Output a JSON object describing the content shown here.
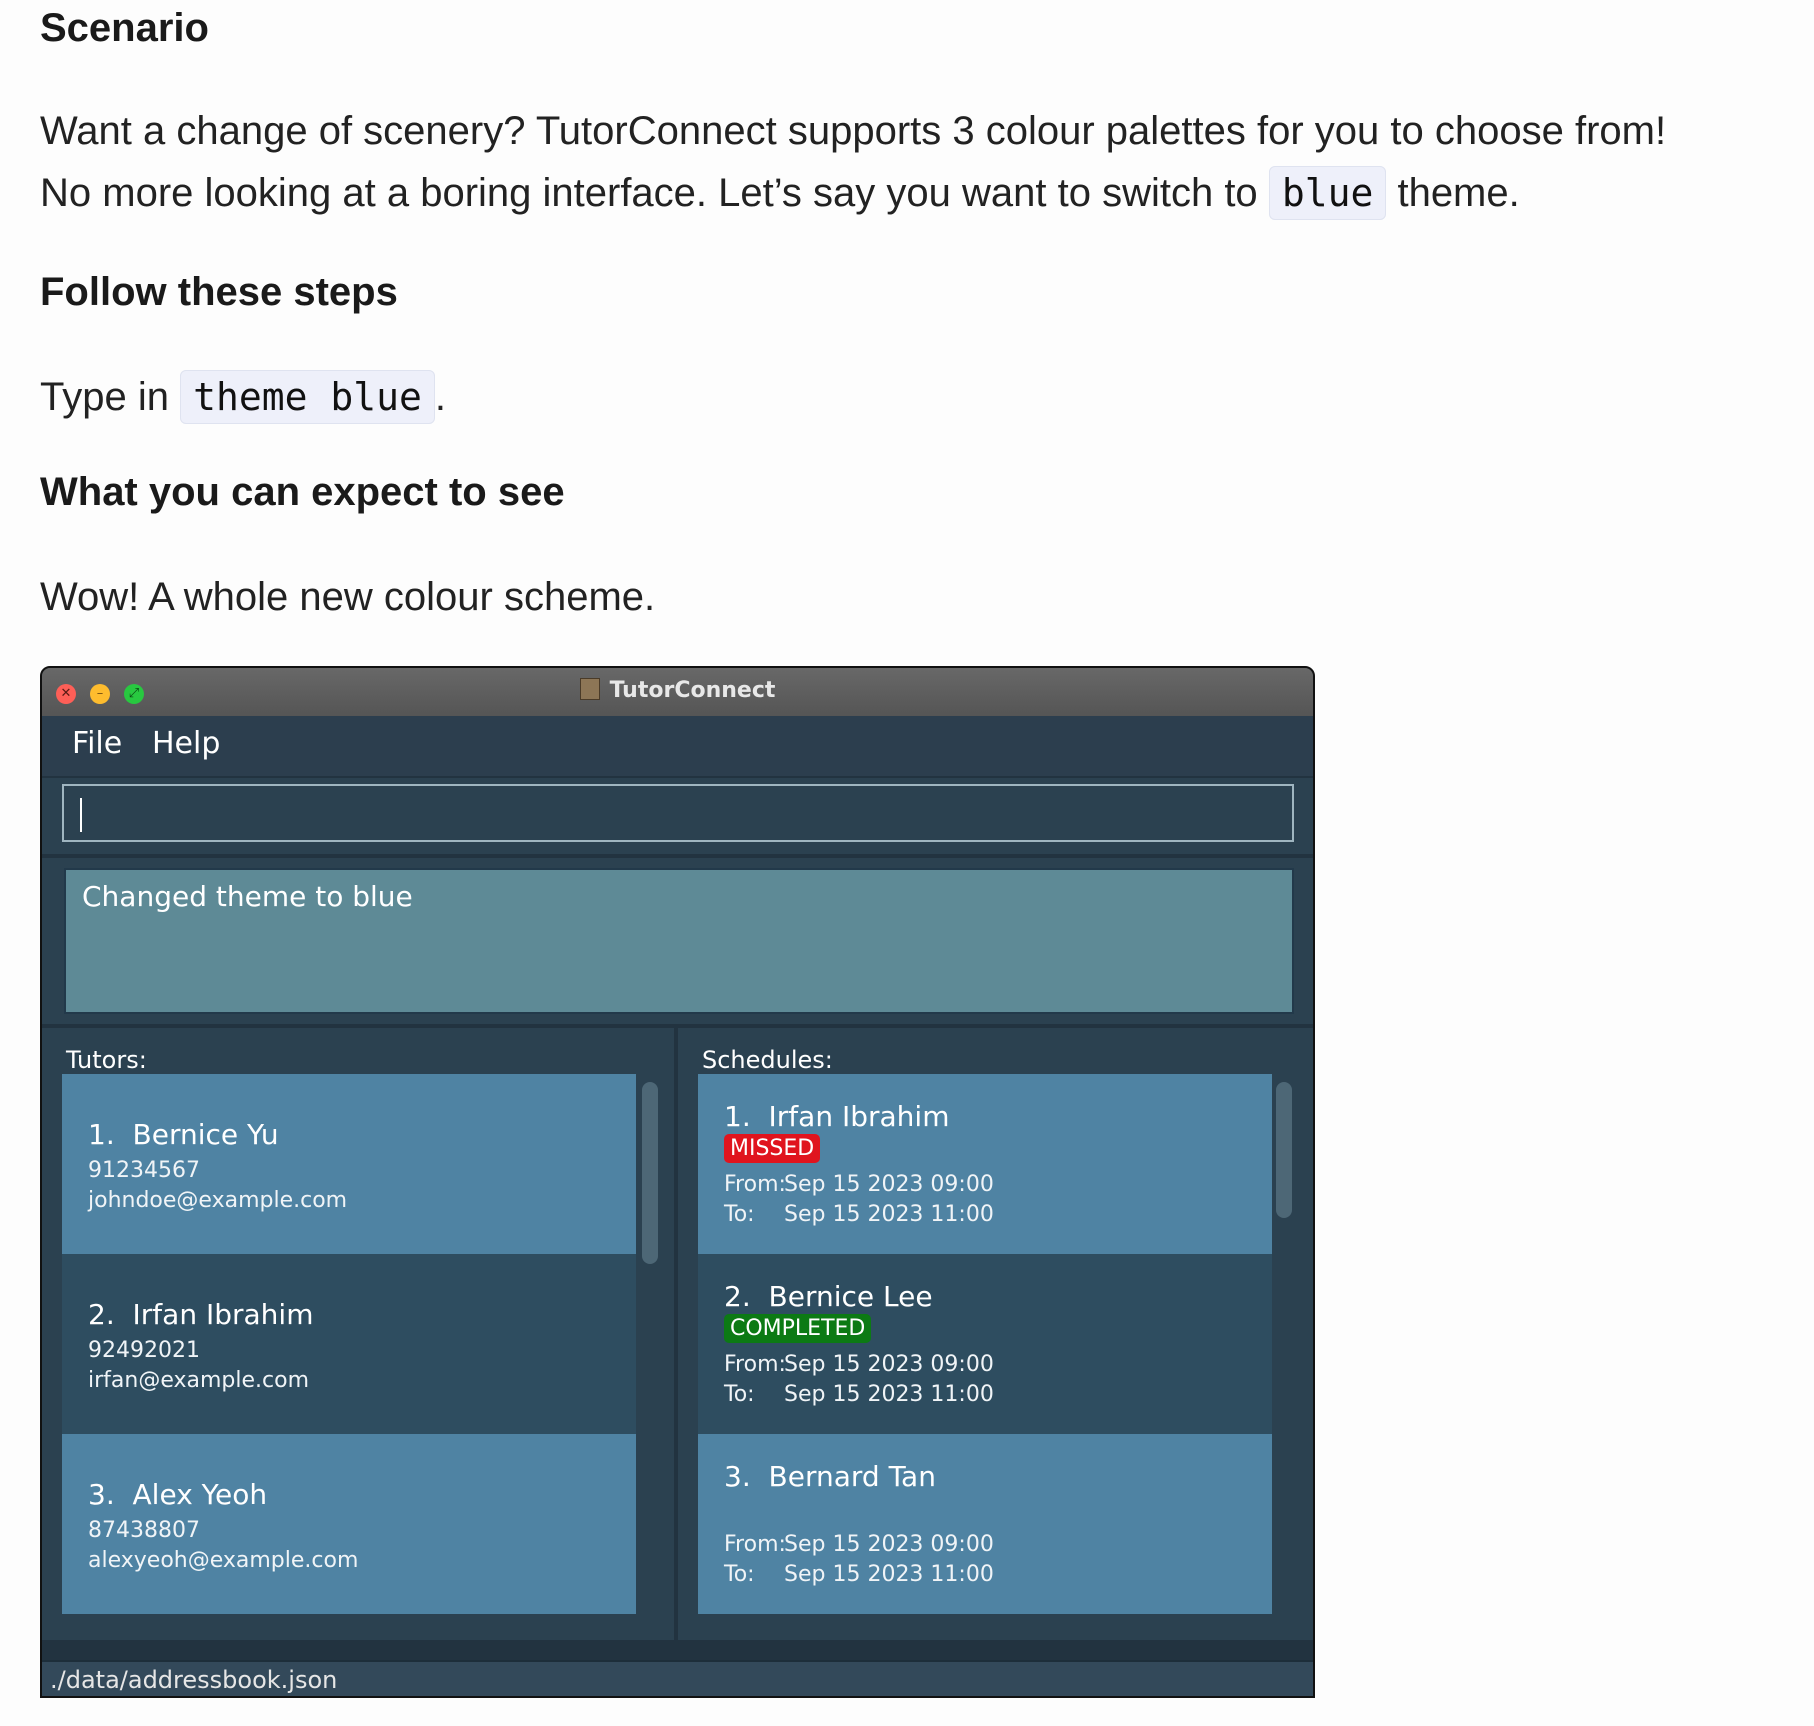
{
  "doc": {
    "scenario_heading": "Scenario",
    "intro_1": "Want a change of scenery? TutorConnect supports 3 colour palettes for you to choose from!",
    "intro_2_pre": "No more looking at a boring interface. Let’s say you want to switch to",
    "intro_2_code": "blue",
    "intro_2_post": "theme.",
    "steps_heading": "Follow these steps",
    "step_pre": "Type in",
    "step_code": "theme blue",
    "step_post": ".",
    "expect_heading": "What you can expect to see",
    "expect_text": "Wow! A whole new colour scheme."
  },
  "app": {
    "title": "TutorConnect",
    "menu": {
      "file": "File",
      "help": "Help"
    },
    "command_value": "",
    "result": "Changed theme to blue",
    "tutors_label": "Tutors:",
    "schedules_label": "Schedules:",
    "tutors": [
      {
        "index": "1.",
        "name": "Bernice Yu",
        "phone": "91234567",
        "email": "johndoe@example.com"
      },
      {
        "index": "2.",
        "name": "Irfan Ibrahim",
        "phone": "92492021",
        "email": "irfan@example.com"
      },
      {
        "index": "3.",
        "name": "Alex Yeoh",
        "phone": "87438807",
        "email": "alexyeoh@example.com"
      }
    ],
    "schedules": [
      {
        "index": "1.",
        "name": "Irfan Ibrahim",
        "status": "MISSED",
        "from_label": "From:",
        "from": "Sep 15 2023 09:00",
        "to_label": "To:",
        "to": "Sep 15 2023 11:00"
      },
      {
        "index": "2.",
        "name": "Bernice Lee",
        "status": "COMPLETED",
        "from_label": "From:",
        "from": "Sep 15 2023 09:00",
        "to_label": "To:",
        "to": "Sep 15 2023 11:00"
      },
      {
        "index": "3.",
        "name": "Bernard Tan",
        "status": "",
        "from_label": "From:",
        "from": "Sep 15 2023 09:00",
        "to_label": "To:",
        "to": "Sep 15 2023 11:00"
      }
    ],
    "status_path": "./data/addressbook.json",
    "colors": {
      "card_light": "#4f83a3",
      "card_dark": "#2e4d60",
      "result_bg": "#5e8a96",
      "missed": "#e0141e",
      "completed": "#0c7a14"
    }
  }
}
